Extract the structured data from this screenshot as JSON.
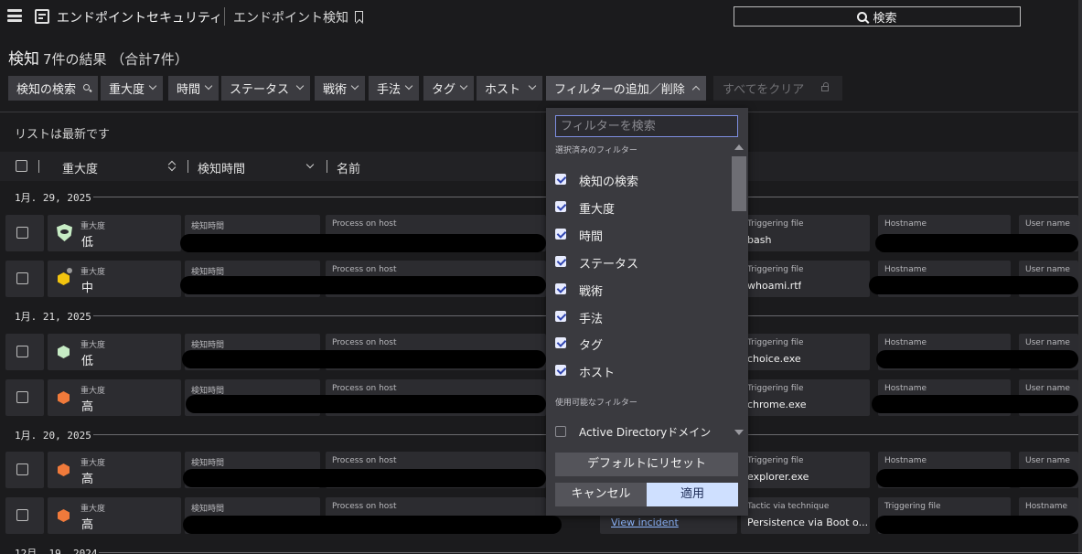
{
  "header": {
    "app_title": "エンドポイントセキュリティ",
    "page_crumb": "エンドポイント検知",
    "search_label": "検索"
  },
  "results": {
    "title": "検知",
    "count_text": "7件の結果 （合計7件）"
  },
  "filters": [
    {
      "label": "検知の検索",
      "icon": "search-icon"
    },
    {
      "label": "重大度",
      "icon": "chevron-down-icon"
    },
    {
      "label": "時間",
      "icon": "chevron-down-icon"
    },
    {
      "label": "ステータス",
      "icon": "chevron-down-icon"
    },
    {
      "label": "戦術",
      "icon": "chevron-down-icon"
    },
    {
      "label": "手法",
      "icon": "chevron-down-icon"
    },
    {
      "label": "タグ",
      "icon": "chevron-down-icon"
    },
    {
      "label": "ホスト",
      "icon": "chevron-down-icon"
    },
    {
      "label": "フィルターの追加／削除",
      "icon": "chevron-up-icon"
    }
  ],
  "clear_all": "すべてをクリア",
  "list": {
    "status": "リストは最新です",
    "columns": [
      "重大度",
      "検知時間",
      "名前"
    ]
  },
  "groups": [
    {
      "date": "1月. 29, 2025",
      "rows": [
        {
          "severity_label": "重大度",
          "severity": "低",
          "severity_icon": "shield-icon",
          "time_label": "検知時間",
          "process_label": "Process on host",
          "file_label": "Triggering file",
          "file_value": "bash",
          "host_label": "Hostname",
          "user_label": "User name"
        },
        {
          "severity_label": "重大度",
          "severity": "中",
          "severity_icon": "hexagon-icon",
          "time_label": "検知時間",
          "process_label": "Process on host",
          "file_label": "Triggering file",
          "file_value": "whoami.rtf",
          "host_label": "Hostname",
          "user_label": "User name"
        }
      ]
    },
    {
      "date": "1月. 21, 2025",
      "rows": [
        {
          "severity_label": "重大度",
          "severity": "低",
          "severity_icon": "hexagon-icon",
          "time_label": "検知時間",
          "process_label": "Process on host",
          "file_label": "Triggering file",
          "file_value": "choice.exe",
          "host_label": "Hostname",
          "user_label": "User name"
        },
        {
          "severity_label": "重大度",
          "severity": "高",
          "severity_icon": "hexagon-icon",
          "time_label": "検知時間",
          "process_label": "Process on host",
          "file_label": "Triggering file",
          "file_value": "chrome.exe",
          "host_label": "Hostname",
          "user_label": "User name"
        }
      ]
    },
    {
      "date": "1月. 20, 2025",
      "rows": [
        {
          "severity_label": "重大度",
          "severity": "高",
          "severity_icon": "hexagon-icon",
          "time_label": "検知時間",
          "process_label": "Process on host",
          "file_label": "Triggering file",
          "file_value": "explorer.exe",
          "host_label": "Hostname",
          "user_label": "User name"
        },
        {
          "severity_label": "重大度",
          "severity": "高",
          "severity_icon": "hexagon-icon",
          "time_label": "検知時間",
          "process_label": "Process on host",
          "link_text": "View incident",
          "file_label": "Tactic via technique",
          "file_value": "Persistence via Boot o...",
          "host_label": "Triggering file",
          "user_label": "Hostname"
        }
      ]
    },
    {
      "date": "12月. 19, 2024",
      "rows": []
    }
  ],
  "filter_dropdown": {
    "search_placeholder": "フィルターを検索",
    "selected_section": "選択済みのフィルター",
    "selected": [
      "検知の検索",
      "重大度",
      "時間",
      "ステータス",
      "戦術",
      "手法",
      "タグ",
      "ホスト"
    ],
    "available_section": "使用可能なフィルター",
    "available": [
      "Active Directoryドメイン"
    ],
    "reset": "デフォルトにリセット",
    "cancel": "キャンセル",
    "apply": "適用"
  },
  "colors": {
    "severity_low": "#c7ecc5",
    "severity_medium": "#f2c40f",
    "severity_high": "#f07a3b",
    "apply_button": "#cfe0ff",
    "link": "#8fb8ff"
  }
}
